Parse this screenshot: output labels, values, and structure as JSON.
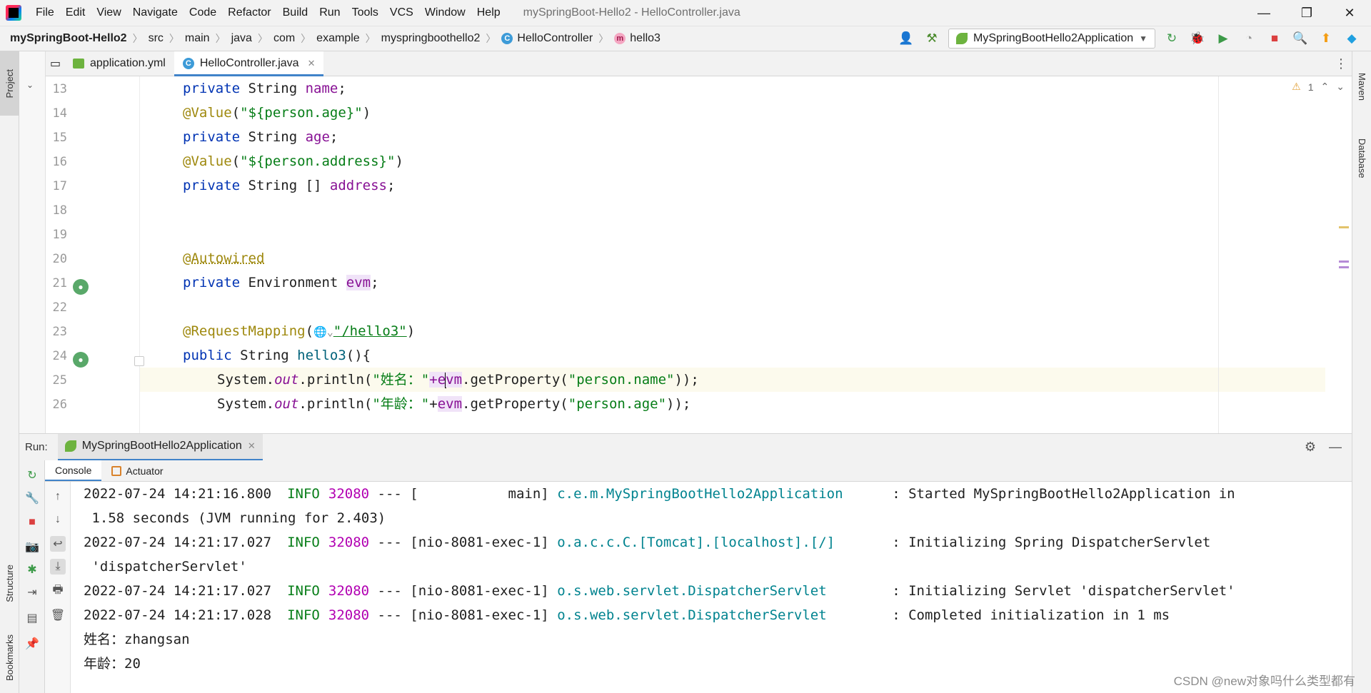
{
  "menubar": {
    "items": [
      "File",
      "Edit",
      "View",
      "Navigate",
      "Code",
      "Refactor",
      "Build",
      "Run",
      "Tools",
      "VCS",
      "Window",
      "Help"
    ],
    "window_title": "mySpringBoot-Hello2 - HelloController.java"
  },
  "breadcrumb": {
    "project": "mySpringBoot-Hello2",
    "items": [
      "src",
      "main",
      "java",
      "com",
      "example",
      "myspringboothello2"
    ],
    "class_name": "HelloController",
    "method_name": "hello3"
  },
  "run_config": {
    "name": "MySpringBootHello2Application"
  },
  "left_strip": {
    "project": "Project",
    "structure": "Structure",
    "bookmarks": "Bookmarks"
  },
  "right_strip": {
    "maven": "Maven",
    "database": "Database"
  },
  "editor_tabs": [
    {
      "label": "application.yml",
      "active": false
    },
    {
      "label": "HelloController.java",
      "active": true
    }
  ],
  "inspection": {
    "warnings": "1"
  },
  "editor": {
    "line_numbers": [
      "13",
      "14",
      "15",
      "16",
      "17",
      "18",
      "19",
      "20",
      "21",
      "22",
      "23",
      "24",
      "25",
      "26"
    ],
    "lines": [
      {
        "kw": "private ",
        "type": "String ",
        "field": "name",
        "rest": ";"
      },
      {
        "ann": "@Value",
        "open": "(",
        "str": "\"${person.age}\"",
        "close": ")"
      },
      {
        "kw": "private ",
        "type": "String ",
        "field": "age",
        "rest": ";"
      },
      {
        "ann": "@Value",
        "open": "(",
        "str": "\"${person.address}\"",
        "close": ")"
      },
      {
        "kw": "private ",
        "type": "String [] ",
        "field": "address",
        "rest": ";"
      },
      {},
      {},
      {
        "ann": "@Autowired"
      },
      {
        "kw": "private ",
        "type": "Environment ",
        "field": "evm",
        "rest": ";"
      },
      {},
      {
        "ann": "@RequestMapping",
        "open": "(",
        "str": "\"/hello3\"",
        "close": ")"
      },
      {
        "kw": "public ",
        "type": "String ",
        "fn": "hello3",
        "rest": "(){"
      },
      {
        "pre": "System.",
        "static": "out",
        "mid": ".println(",
        "str": "\"姓名：\"",
        "plus": "+e",
        "after_caret": "vm",
        "tail": ".getProperty(",
        "str2": "\"person.name\"",
        "end": "));"
      },
      {
        "pre": "System.",
        "static": "out",
        "mid": ".println(",
        "str": "\"年龄：\"",
        "plus": "+",
        "field": "evm",
        "tail": ".getProperty(",
        "str2": "\"person.age\"",
        "end": "));"
      }
    ]
  },
  "run_panel": {
    "label": "Run:",
    "tab": "MySpringBootHello2Application",
    "subtabs": [
      "Console",
      "Actuator"
    ]
  },
  "console": {
    "logs": [
      {
        "ts": "2022-07-24 14:21:16.800",
        "level": "INFO",
        "pid": "32080",
        "thread": " --- [           main] ",
        "logger": "c.e.m.MySpringBootHello2Application     ",
        "msg": " : Started MySpringBootHello2Application in",
        "cont": " 1.58 seconds (JVM running for 2.403)"
      },
      {
        "ts": "2022-07-24 14:21:17.027",
        "level": "INFO",
        "pid": "32080",
        "thread": " --- [nio-8081-exec-1] ",
        "logger": "o.a.c.c.C.[Tomcat].[localhost].[/]      ",
        "msg": " : Initializing Spring DispatcherServlet",
        "cont": " 'dispatcherServlet'"
      },
      {
        "ts": "2022-07-24 14:21:17.027",
        "level": "INFO",
        "pid": "32080",
        "thread": " --- [nio-8081-exec-1] ",
        "logger": "o.s.web.servlet.DispatcherServlet       ",
        "msg": " : Initializing Servlet 'dispatcherServlet'",
        "cont": ""
      },
      {
        "ts": "2022-07-24 14:21:17.028",
        "level": "INFO",
        "pid": "32080",
        "thread": " --- [nio-8081-exec-1] ",
        "logger": "o.s.web.servlet.DispatcherServlet       ",
        "msg": " : Completed initialization in 1 ms",
        "cont": ""
      }
    ],
    "output": [
      "姓名：zhangsan",
      "年龄：20"
    ]
  },
  "watermark": "CSDN @new对象吗什么类型都有",
  "colors": {
    "keyword": "#0033b3",
    "annotation": "#9e880d",
    "string": "#067d17",
    "field": "#871094",
    "accent": "#4083c9",
    "log_info": "#067d17",
    "log_pid": "#b200b2",
    "log_logger": "#00838f"
  }
}
